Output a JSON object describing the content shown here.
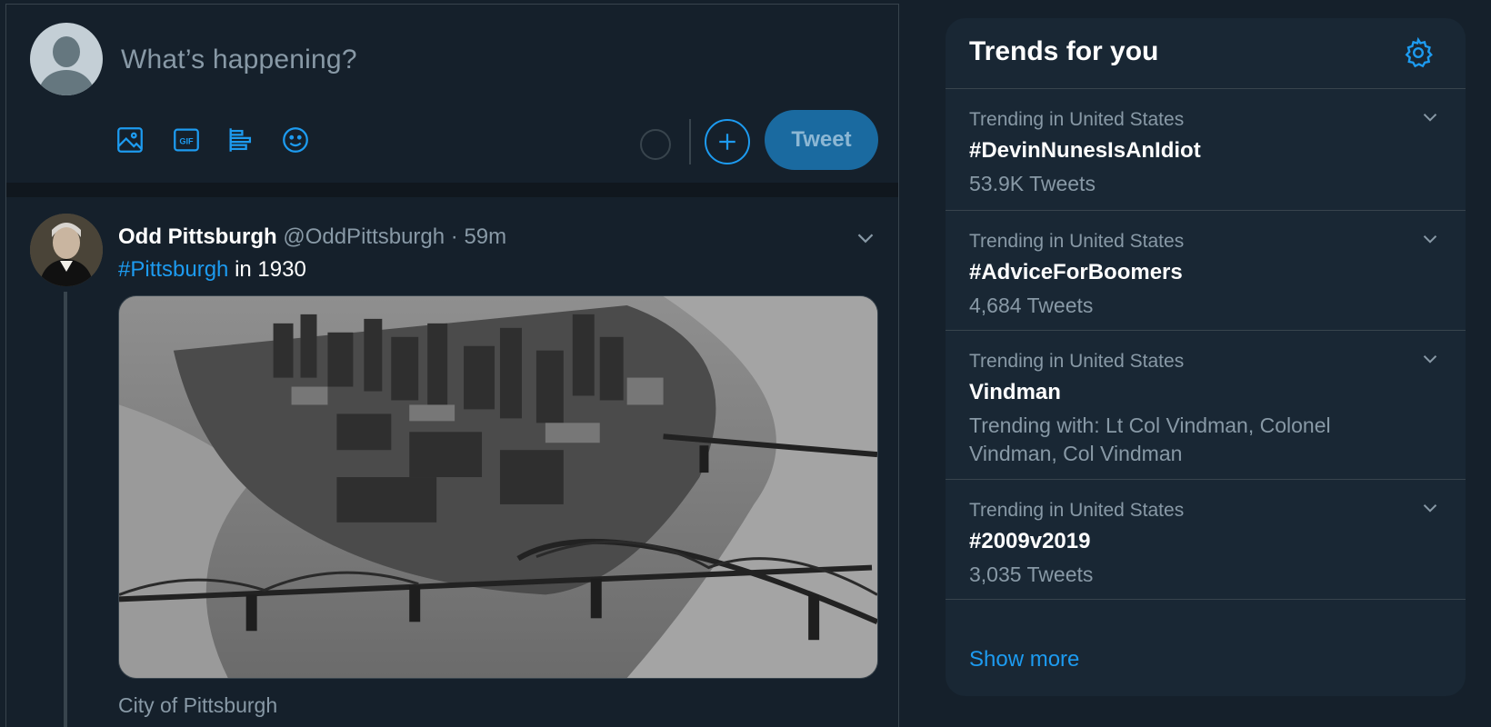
{
  "composer": {
    "placeholder": "What’s happening?",
    "tweet_button": "Tweet",
    "icons": [
      "image-icon",
      "gif-icon",
      "poll-icon",
      "emoji-icon",
      "progress-ring",
      "add-thread-icon"
    ],
    "gif_label": "GIF"
  },
  "tweet": {
    "author_name": "Odd Pittsburgh",
    "meta": "@OddPittsburgh · 59m",
    "hashtag": "#Pittsburgh",
    "text_rest": " in 1930",
    "source": "City of Pittsburgh"
  },
  "trends": {
    "title": "Trends for you",
    "items": [
      {
        "context": "Trending in United States",
        "name": "#DevinNunesIsAnIdiot",
        "sub": "53.9K Tweets"
      },
      {
        "context": "Trending in United States",
        "name": "#AdviceForBoomers",
        "sub": "4,684 Tweets"
      },
      {
        "context": "Trending in United States",
        "name": "Vindman",
        "sub": "Trending with: Lt Col Vindman, Colonel Vindman, Col Vindman"
      },
      {
        "context": "Trending in United States",
        "name": "#2009v2019",
        "sub": "3,035 Tweets"
      }
    ],
    "show_more": "Show more"
  },
  "colors": {
    "background": "#15202b",
    "panel": "#192734",
    "accent": "#1d9bf0",
    "muted_text": "#8899a6",
    "border": "#38444d"
  }
}
